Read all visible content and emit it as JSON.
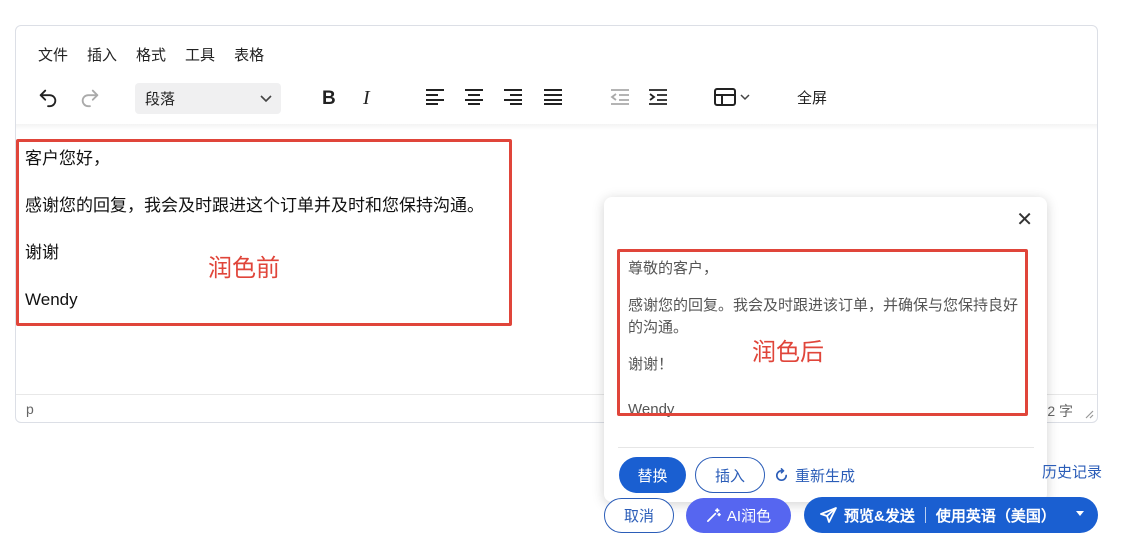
{
  "menu": [
    "文件",
    "插入",
    "格式",
    "工具",
    "表格"
  ],
  "toolbar": {
    "block_format": "段落",
    "fullscreen_label": "全屏",
    "icons": [
      "undo-icon",
      "redo-icon",
      "bold-icon",
      "italic-icon",
      "align-left-icon",
      "align-center-icon",
      "align-right-icon",
      "align-justify-icon",
      "outdent-icon",
      "indent-icon",
      "table-icon"
    ]
  },
  "editor": {
    "paragraphs": [
      "客户您好，",
      "感谢您的回复，我会及时跟进这个订单并及时和您保持沟通。",
      "谢谢",
      "Wendy"
    ],
    "annotation_before": "润色前",
    "status_path": "p",
    "word_count": "2 字"
  },
  "popup": {
    "close_glyph": "✕",
    "paragraphs": [
      "尊敬的客户，",
      "感谢您的回复。我会及时跟进该订单，并确保与您保持良好的沟通。",
      "谢谢！",
      "Wendy"
    ],
    "annotation_after": "润色后",
    "replace_label": "替换",
    "insert_label": "插入",
    "regenerate_label": "重新生成"
  },
  "history_label": "历史记录",
  "footer": {
    "cancel_label": "取消",
    "ai_label": "AI润色",
    "send_label": "预览&发送",
    "language_label": "使用英语（美国）"
  },
  "colors": {
    "primary": "#1a5fd1",
    "ai_button": "#5666f0",
    "annotation_red": "#e0453a"
  }
}
